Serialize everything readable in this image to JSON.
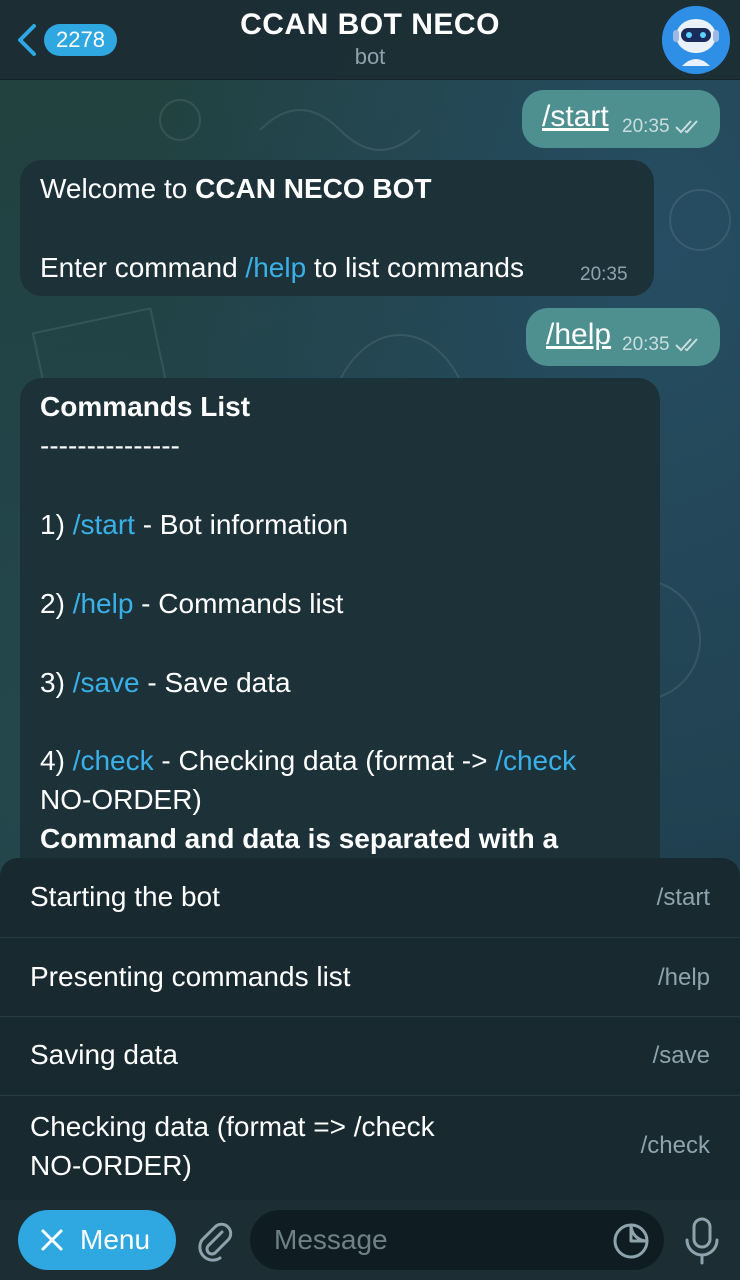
{
  "header": {
    "unread_count": "2278",
    "title": "CCAN BOT NECO",
    "subtitle": "bot"
  },
  "messages": {
    "m1": {
      "text": "/start",
      "time": "20:35"
    },
    "m2": {
      "line1_prefix": "Welcome to ",
      "line1_bold": "CCAN NECO BOT",
      "line2_prefix": "Enter command ",
      "line2_link": "/help",
      "line2_suffix": " to list commands",
      "time": "20:35"
    },
    "m3": {
      "text": "/help",
      "time": "20:35"
    },
    "m4": {
      "title": "Commands List",
      "divider": "---------------",
      "item1_num": "1) ",
      "item1_cmd": "/start",
      "item1_desc": " - Bot information",
      "item2_num": "2) ",
      "item2_cmd": "/help",
      "item2_desc": " - Commands list",
      "item3_num": "3) ",
      "item3_cmd": "/save",
      "item3_desc": " - Save data",
      "item4_num": "4) ",
      "item4_cmd": "/check",
      "item4_desc": " - Checking data (format -> ",
      "item4_cmd2": "/check",
      "item4_tail": "NO-ORDER)",
      "footer_bold": "Command and data is separated with a"
    }
  },
  "command_panel": {
    "items": [
      {
        "desc": "Starting the bot",
        "cmd": "/start"
      },
      {
        "desc": "Presenting commands list",
        "cmd": "/help"
      },
      {
        "desc": "Saving data",
        "cmd": "/save"
      },
      {
        "desc_line1": "Checking data (format => /check",
        "desc_line2": "NO-ORDER)",
        "cmd": "/check"
      }
    ]
  },
  "input_bar": {
    "menu_label": "Menu",
    "placeholder": "Message"
  },
  "colors": {
    "accent": "#2fa7e0",
    "outgoing_bubble": "#4e8f8f",
    "incoming_bubble": "#1d3238",
    "link": "#3ab0e8"
  },
  "icons": [
    "chevron-left-icon",
    "robot-avatar-icon",
    "double-check-icon",
    "close-icon",
    "paperclip-icon",
    "sticker-icon",
    "microphone-icon"
  ]
}
